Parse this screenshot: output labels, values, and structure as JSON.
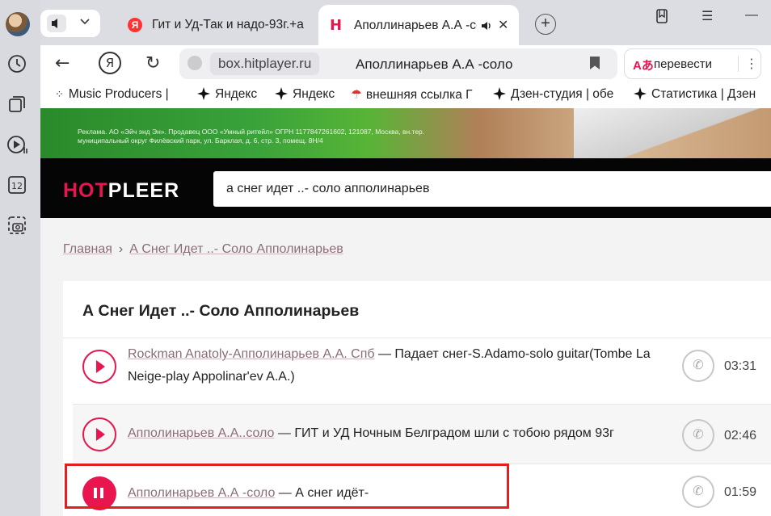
{
  "tabs": [
    {
      "title": "Гит и Уд-Так и надо-93г.+а",
      "favicon": "Я"
    },
    {
      "title": "Аполлинарьев А.А -соло",
      "favicon": "H"
    }
  ],
  "toolbar": {
    "host": "box.hitplayer.ru",
    "page_title": "Аполлинарьев А.А -соло",
    "yandex_glyph": "Я",
    "translate_label": "перевести",
    "translate_icon": "Aあ"
  },
  "bookmarks": [
    {
      "label": "Music Producers |"
    },
    {
      "label": "Яндекс"
    },
    {
      "label": "Яндекс"
    },
    {
      "label": "внешняя ссылка Г"
    },
    {
      "label": "Дзен-студия | обе"
    },
    {
      "label": "Статистика | Дзен"
    }
  ],
  "banner": {
    "legal": "Реклама. АО «Эйч энд Эн». Продавец ООО «Умный ритейл» ОГРН 1177847261602, 121087, Москва, вн.тер. муниципальный округ Филёвский парк, ул. Барклая, д. 6, стр. 3, помещ. 8Н/4"
  },
  "site": {
    "logo_hot": "HOT",
    "logo_pleer": "PLEER",
    "search_value": "а снег идет ..- соло апполинарьев"
  },
  "breadcrumb": {
    "home": "Главная",
    "current": "А Снег Идет ..- Соло Апполинарьев"
  },
  "results": {
    "heading": "А Снег Идет ..- Соло Апполинарьев",
    "items": [
      {
        "artist": "Rockman Anatoly-Апполинарьев А.А. Спб",
        "title": "— Падает снег-S.Adamo-solo guitar(Tombe La Neige-play Appolinar'ev A.A.)",
        "duration": "03:31",
        "state": "play"
      },
      {
        "artist": "Апполинарьев А.А..соло",
        "title": "— ГИТ и УД Ночным Белградом шли с тобою рядом 93г",
        "duration": "02:46",
        "state": "play"
      },
      {
        "artist": "Апполинарьев А.А -соло",
        "title": "— А снег идёт-",
        "duration": "01:59",
        "state": "pause"
      }
    ]
  },
  "colors": {
    "accent": "#e8154e",
    "highlight": "#e02020"
  }
}
